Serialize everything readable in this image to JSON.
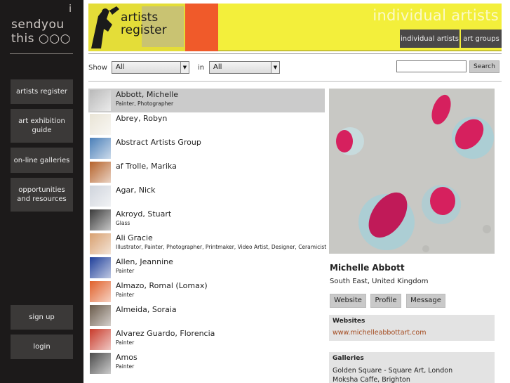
{
  "logo": {
    "line0": "i",
    "line1": "sendyou",
    "line2": "this ○○○"
  },
  "sidebar": {
    "items": [
      {
        "label": "artists register"
      },
      {
        "label": "art exhibition guide"
      },
      {
        "label": "on-line galleries"
      },
      {
        "label": "opportunities and resources"
      },
      {
        "label": "sign up"
      },
      {
        "label": "login"
      }
    ]
  },
  "header": {
    "brand_line1": "artists",
    "brand_line2": "register",
    "title": "individual artists",
    "tabs": [
      {
        "label": "individual artists"
      },
      {
        "label": "art groups"
      }
    ]
  },
  "filters": {
    "show_label": "Show",
    "show_value": "All",
    "in_label": "in",
    "in_value": "All",
    "search_value": "",
    "search_button": "Search"
  },
  "artists": [
    {
      "name": "Abbott, Michelle",
      "disciplines": "Painter, Photographer",
      "thumb_color": "#b9b9b9"
    },
    {
      "name": "Abrey, Robyn",
      "disciplines": "",
      "thumb_color": "#e9e4d6"
    },
    {
      "name": "Abstract Artists Group",
      "disciplines": "",
      "thumb_color": "#4a7fb8"
    },
    {
      "name": "af Trolle, Marika",
      "disciplines": "",
      "thumb_color": "#b5622a"
    },
    {
      "name": "Agar, Nick",
      "disciplines": "",
      "thumb_color": "#cfd4dc"
    },
    {
      "name": "Akroyd, Stuart",
      "disciplines": "Glass",
      "thumb_color": "#3a3a3a"
    },
    {
      "name": "Ali Gracie",
      "disciplines": "Illustrator, Painter, Photographer, Printmaker, Video Artist, Designer, Ceramicist",
      "thumb_color": "#d8a070"
    },
    {
      "name": "Allen, Jeannine",
      "disciplines": "Painter",
      "thumb_color": "#1f3f9a"
    },
    {
      "name": "Almazo, Romal (Lomax)",
      "disciplines": "Painter",
      "thumb_color": "#e0602a"
    },
    {
      "name": "Almeida, Soraia",
      "disciplines": "",
      "thumb_color": "#6a5a4a"
    },
    {
      "name": "Alvarez Guardo, Florencia",
      "disciplines": "Painter",
      "thumb_color": "#c83a2a"
    },
    {
      "name": "Amos",
      "disciplines": "Painter",
      "thumb_color": "#4a4a4a"
    }
  ],
  "profile": {
    "name": "Michelle Abbott",
    "location": "South East, United Kingdom",
    "buttons": [
      {
        "label": "Website"
      },
      {
        "label": "Profile"
      },
      {
        "label": "Message"
      }
    ],
    "websites_heading": "Websites",
    "website_url": "www.michelleabbottart.com",
    "galleries_heading": "Galleries",
    "galleries": [
      "Golden Square - Square Art, London",
      "Moksha Caffe, Brighton"
    ]
  }
}
